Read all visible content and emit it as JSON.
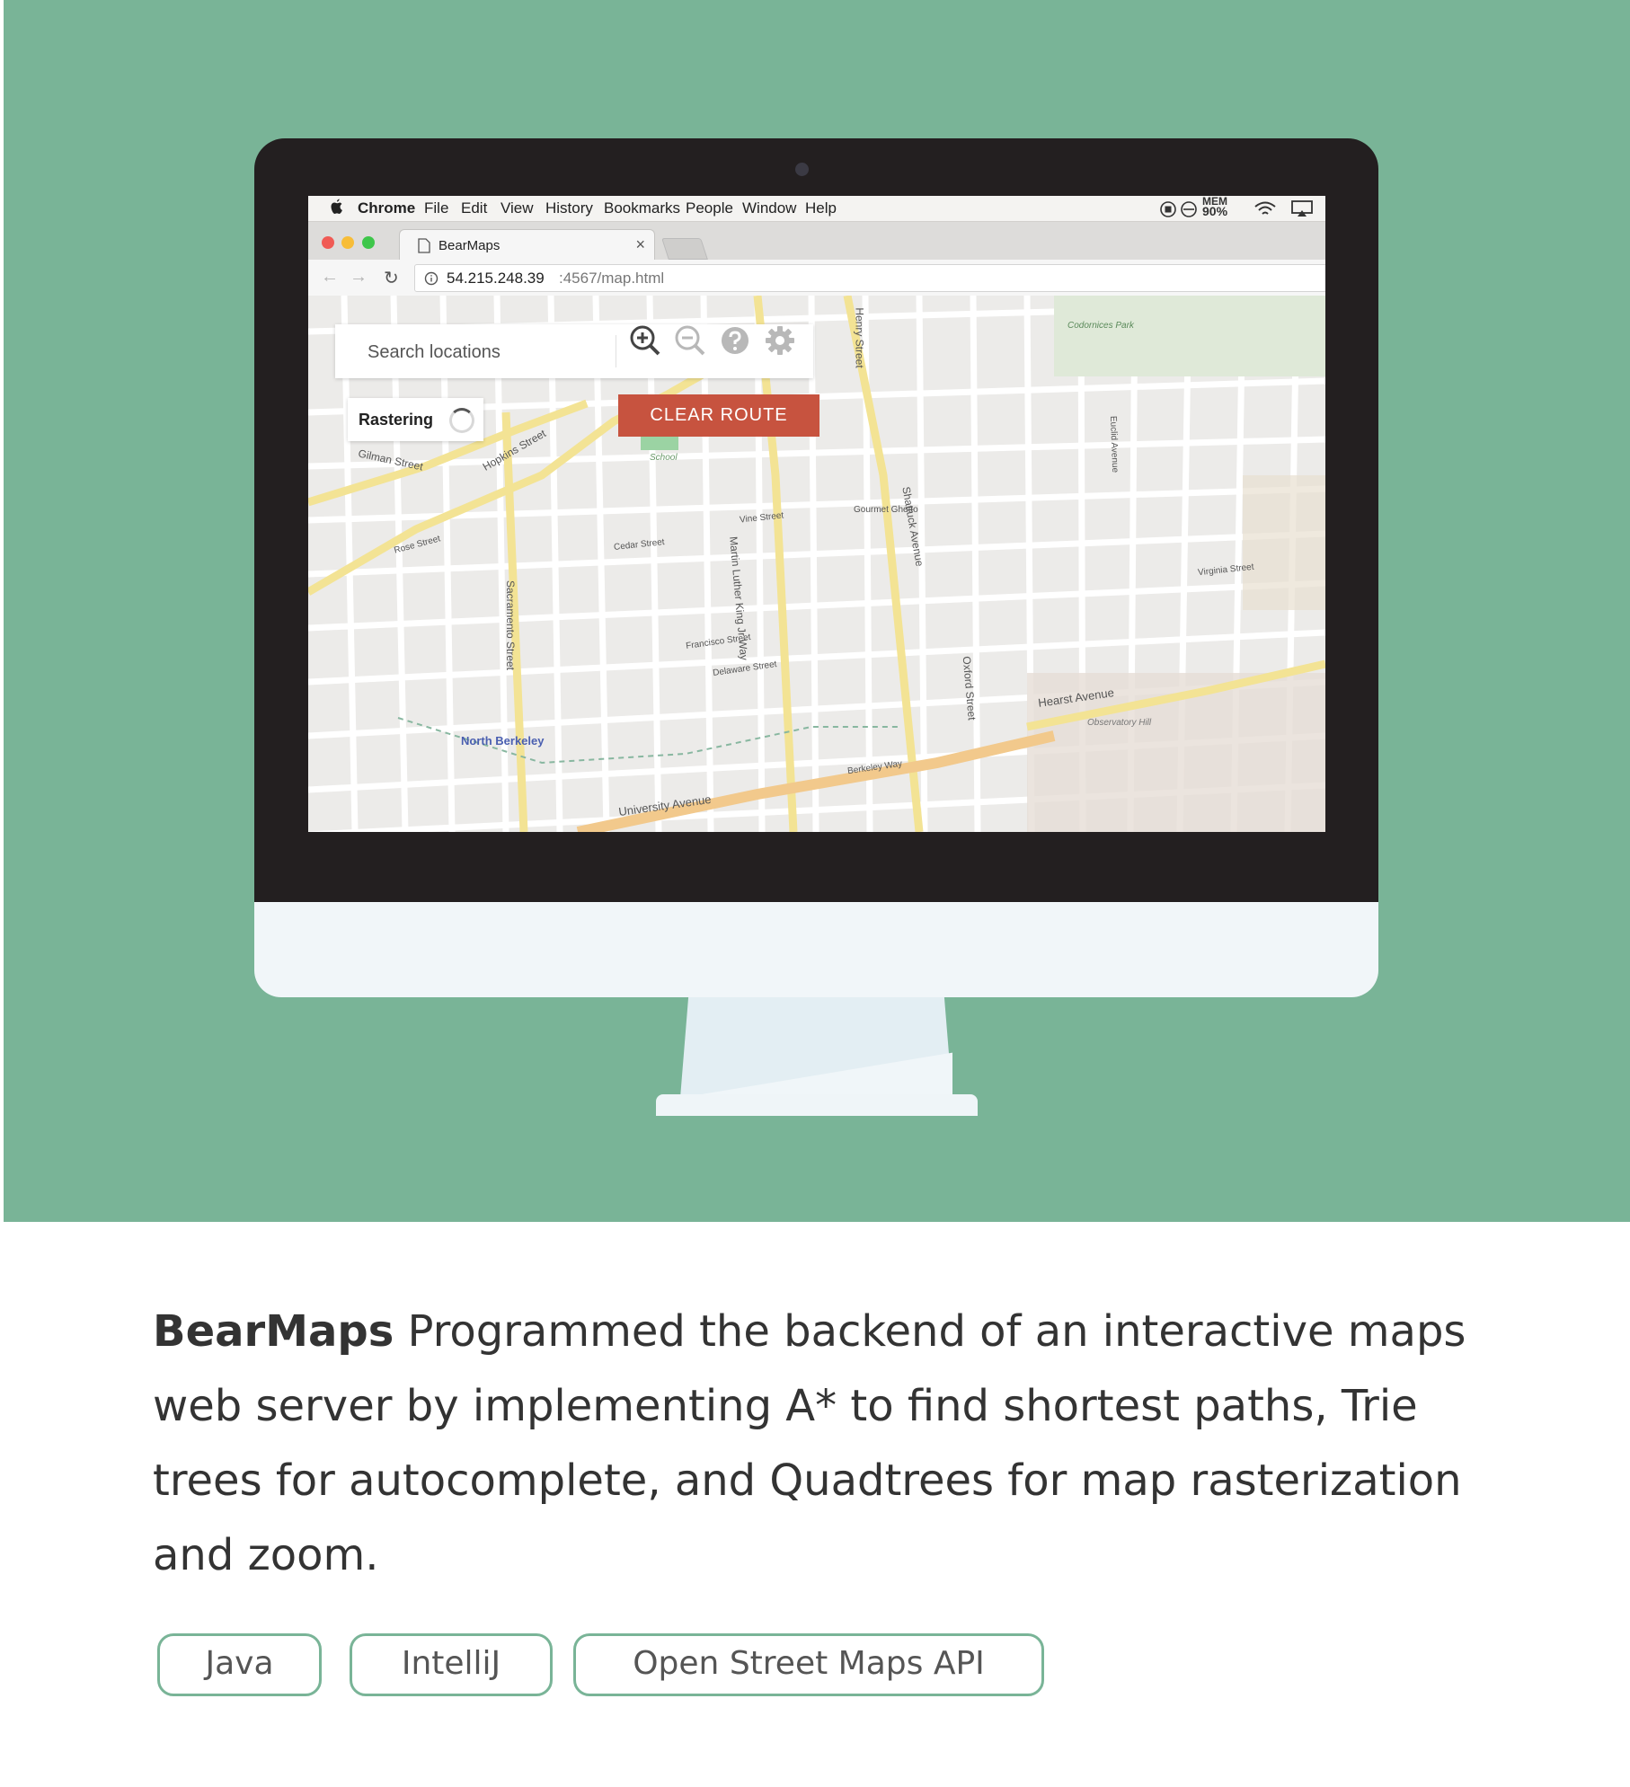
{
  "colors": {
    "hero_background": "#79b497",
    "clear_route": "#c7533f",
    "tag_border": "#79b497"
  },
  "menubar": {
    "app_name": "Chrome",
    "items": [
      "File",
      "Edit",
      "View",
      "History",
      "Bookmarks",
      "People",
      "Window",
      "Help"
    ],
    "mem_label": "MEM",
    "mem_value": "90%"
  },
  "browser": {
    "tab_title": "BearMaps",
    "tab_close": "×",
    "url_host": "54.215.248.39",
    "url_path": ":4567/map.html"
  },
  "map_app": {
    "search_placeholder": "Search locations",
    "rastering_label": "Rastering",
    "clear_route_label": "CLEAR ROUTE",
    "controls": [
      "zoom-in-icon",
      "zoom-out-icon",
      "help-icon",
      "gear-icon"
    ],
    "street_labels": [
      "Henry Street",
      "Shattuck Avenue",
      "Sacramento Street",
      "Martin Luther King Jr Way",
      "Oxford Street",
      "Hearst Avenue",
      "Cedar Street",
      "Hopkins Street",
      "University Avenue",
      "North Berkeley",
      "Gilman Street",
      "Vine Street",
      "Rose Street",
      "Euclid Avenue",
      "Codornices Park",
      "Observatory Hill",
      "School",
      "Gourmet Ghetto",
      "Virginia Street",
      "Delaware Street",
      "Francisco Street",
      "Berkeley Way"
    ]
  },
  "caption": {
    "title": "BearMaps",
    "text": " Programmed the backend of an interactive maps web server by implementing A* to find shortest paths, Trie trees for autocomplete, and Quadtrees for map rasterization and zoom."
  },
  "tags": [
    "Java",
    "IntelliJ",
    "Open Street Maps API"
  ]
}
